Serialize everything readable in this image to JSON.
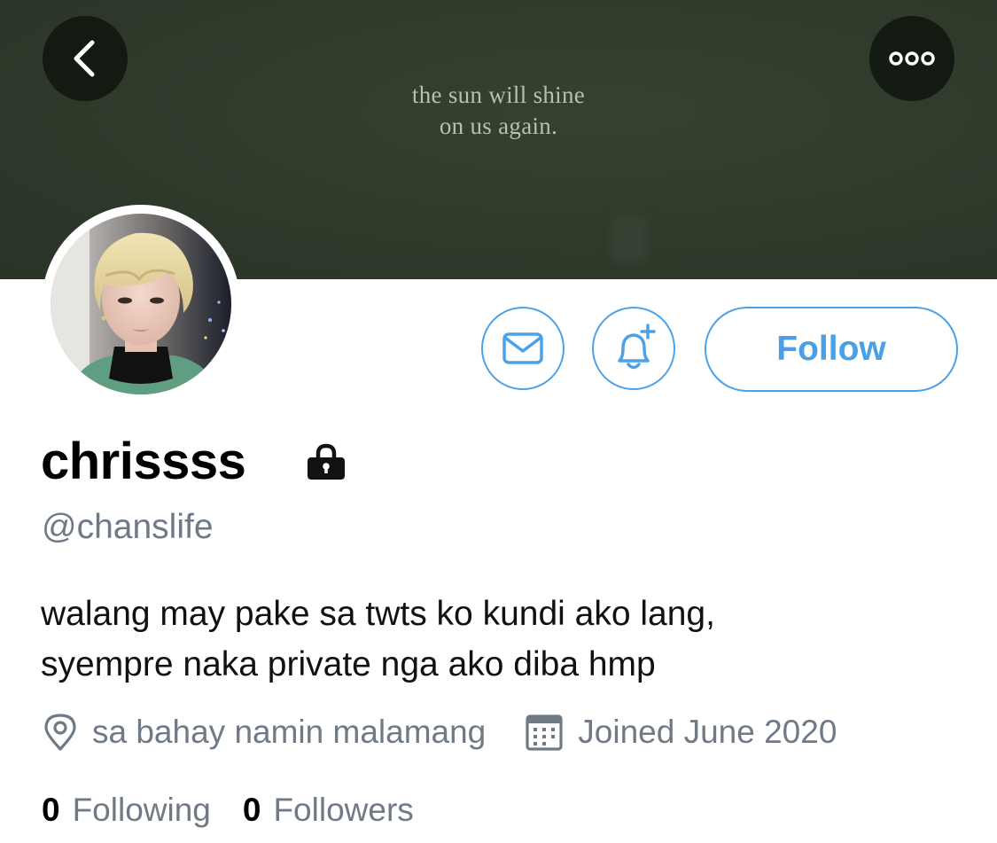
{
  "banner": {
    "line1": "the sun will shine",
    "line2": "on us again."
  },
  "header": {
    "back_icon": "chevron-left-icon",
    "more_icon": "more-horizontal-icon"
  },
  "actions": {
    "message_icon": "mail-icon",
    "notify_icon": "bell-plus-icon",
    "follow_label": "Follow",
    "accent_color": "#4da1e7"
  },
  "profile": {
    "display_name": "chrissss",
    "protected_icon": "lock-icon",
    "handle": "@chanslife",
    "bio_line1": "walang may pake sa twts ko kundi ako lang,",
    "bio_line2": "syempre naka private nga ako diba hmp",
    "location": "sa bahay namin malamang",
    "joined": "Joined June 2020"
  },
  "stats": {
    "following_count": "0",
    "following_label": "Following",
    "followers_count": "0",
    "followers_label": "Followers"
  }
}
